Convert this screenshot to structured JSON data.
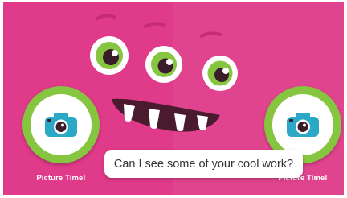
{
  "prompt": {
    "text": "Can I see some of your cool work?"
  },
  "left_button": {
    "label": "Picture Time!",
    "icon": "camera-icon"
  },
  "right_button": {
    "label": "Picture Time!",
    "icon": "camera-icon"
  },
  "colors": {
    "background": "#e03a8a",
    "accent_green": "#86c540",
    "camera_blue": "#2aa8c6",
    "monster_dark": "#4a1a2e"
  }
}
